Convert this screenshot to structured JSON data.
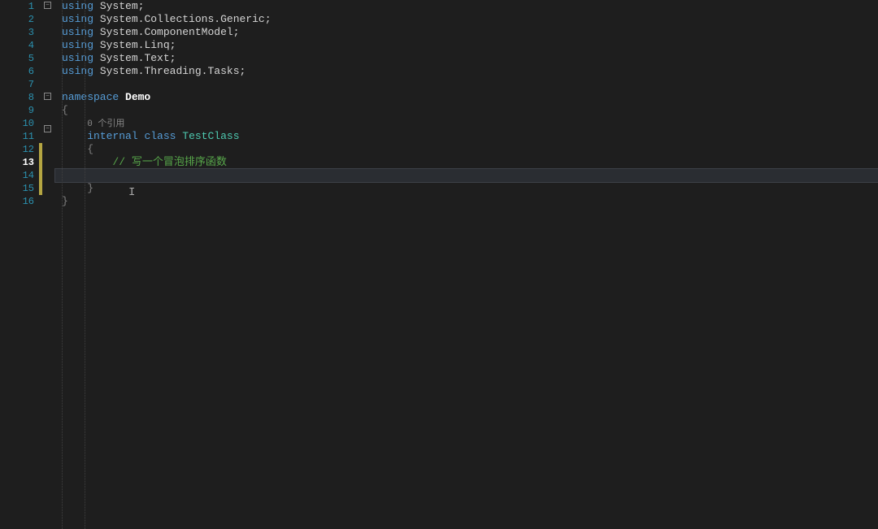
{
  "line_numbers": [
    "1",
    "2",
    "3",
    "4",
    "5",
    "6",
    "7",
    "8",
    "9",
    "10",
    "11",
    "12",
    "13",
    "14",
    "15",
    "16"
  ],
  "current_line": 13,
  "glyph": "✎",
  "fold": {
    "minus": "−"
  },
  "codelens": {
    "ref_count": "0 个引用"
  },
  "code": {
    "l1": {
      "using": "using",
      "ns": "System",
      "semi": ";"
    },
    "l2": {
      "using": "using",
      "ns1": "System",
      "dot": ".",
      "ns2": "Collections",
      "ns3": "Generic",
      "semi": ";"
    },
    "l3": {
      "using": "using",
      "ns1": "System",
      "dot": ".",
      "ns2": "ComponentModel",
      "semi": ";"
    },
    "l4": {
      "using": "using",
      "ns1": "System",
      "dot": ".",
      "ns2": "Linq",
      "semi": ";"
    },
    "l5": {
      "using": "using",
      "ns1": "System",
      "dot": ".",
      "ns2": "Text",
      "semi": ";"
    },
    "l6": {
      "using": "using",
      "ns1": "System",
      "dot": ".",
      "ns2": "Threading",
      "ns3": "Tasks",
      "semi": ";"
    },
    "l8": {
      "kw": "namespace",
      "name": "Demo"
    },
    "l9": {
      "brace": "{"
    },
    "l10": {
      "kw1": "internal",
      "kw2": "class",
      "name": "TestClass"
    },
    "l11": {
      "brace": "{"
    },
    "l12": {
      "comment": "// 写一个冒泡排序函数"
    },
    "l14": {
      "brace": "}"
    },
    "l15": {
      "brace": "}"
    }
  }
}
